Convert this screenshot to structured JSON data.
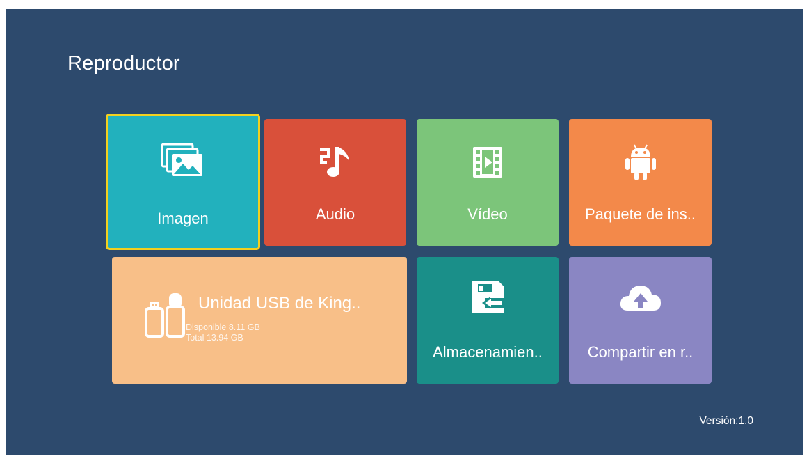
{
  "page": {
    "title": "Reproductor"
  },
  "tiles": {
    "imagen": {
      "label": "Imagen",
      "icon": "image-gallery-icon",
      "color": "#22b1bd",
      "selected": true
    },
    "audio": {
      "label": "Audio",
      "icon": "music-note-icon",
      "color": "#d9503a"
    },
    "video": {
      "label": "Vídeo",
      "icon": "film-icon",
      "color": "#7cc57a"
    },
    "paquete": {
      "label": "Paquete de ins..",
      "icon": "android-icon",
      "color": "#f3894a"
    },
    "almacenamiento": {
      "label": "Almacenamien..",
      "icon": "storage-transfer-icon",
      "color": "#1a8f89"
    },
    "compartir": {
      "label": "Compartir en r..",
      "icon": "cloud-upload-icon",
      "color": "#8a86c3"
    }
  },
  "usb": {
    "name": "Unidad USB de King..",
    "available": "Disponible 8.11 GB",
    "total": "Total 13.94 GB",
    "icon": "usb-drive-icon",
    "color": "#f8bf88"
  },
  "footer": {
    "version": "Versión:1.0"
  },
  "colors": {
    "background": "#2d4a6d",
    "focus_border": "#f3d01e"
  }
}
